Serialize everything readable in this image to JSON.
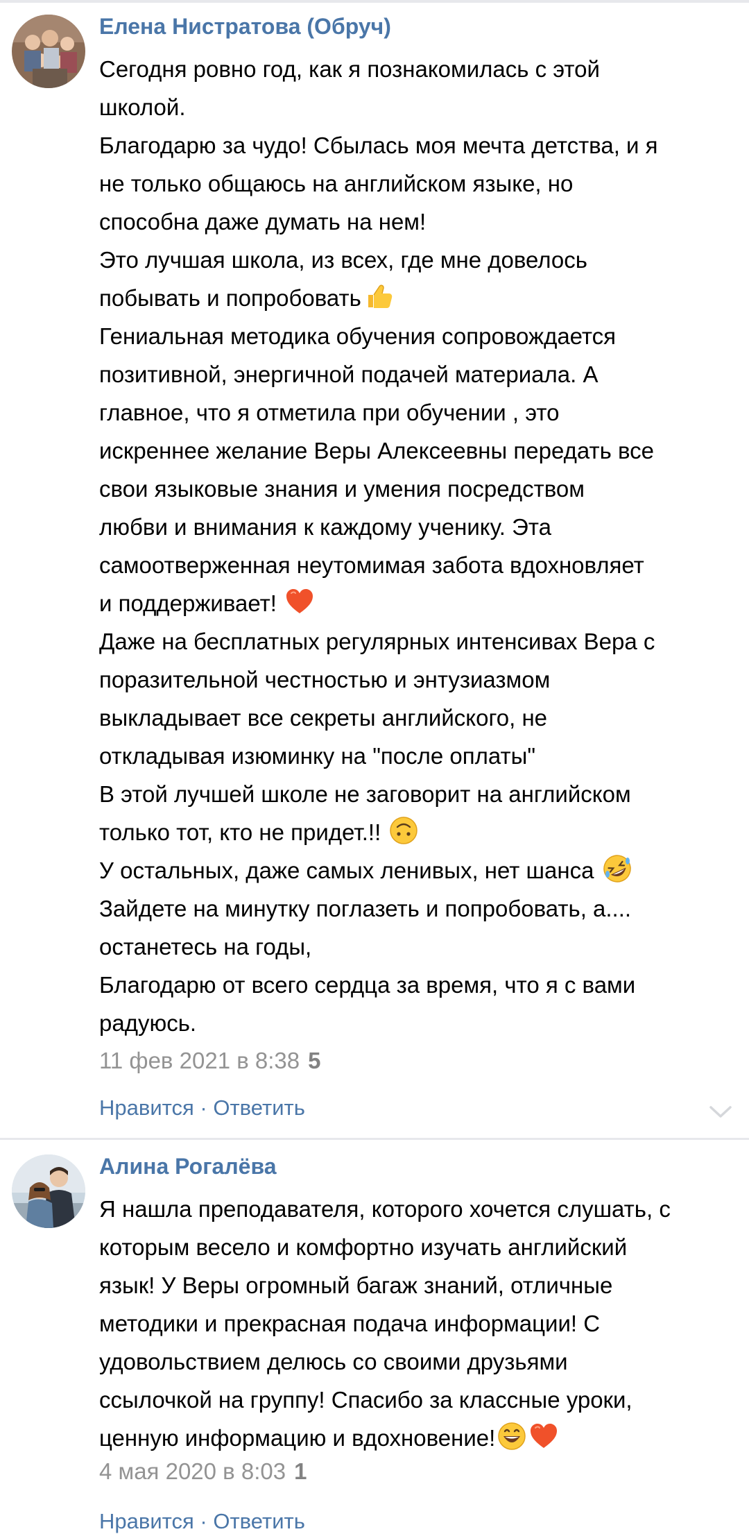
{
  "comments": [
    {
      "author": "Елена Нистратова (Обруч)",
      "lines": [
        "Сегодня ровно год, как я познакомилась с этой",
        "школой.",
        "Благодарю за чудо! Сбылась моя мечта детства, и я",
        "не только общаюсь на английском языке, но",
        "способна даже думать на нем!",
        "Это лучшая школа, из всех, где мне довелось",
        "побывать и попробовать",
        "Гениальная методика обучения сопровождается",
        "позитивной, энергичной подачей материала. А",
        "главное, что я отметила при обучении , это",
        "искреннее желание Веры Алексеевны передать все",
        "свои языковые знания и умения посредством",
        "любви и внимания к каждому ученику. Эта",
        "самоотверженная неутомимая забота вдохновляет",
        "и поддерживает!",
        "Даже на бесплатных регулярных интенсивах Вера с",
        "поразительной честностью и энтузиазмом",
        "выкладывает все секреты английского, не",
        "откладывая изюминку на \"после оплаты\"",
        "В этой лучшей школе не заговорит на английском",
        "только тот, кто не придет.!!",
        "У остальных, даже самых ленивых, нет шанса",
        "Зайдете на минутку поглазеть и попробовать, а....",
        "останетесь на годы,",
        "Благодарю от всего сердца за время, что я с вами",
        "радуюсь."
      ],
      "emojis": [
        "thumbs-up-emoji",
        "heart-emoji",
        "upside-down-face-emoji",
        "rolling-laughing-emoji"
      ],
      "date": "11 фев 2021 в 8:38",
      "likes": "5",
      "like_label": "Нравится",
      "separator": " · ",
      "reply_label": "Ответить"
    },
    {
      "author": "Алина Рогалёва",
      "lines": [
        "Я нашла преподавателя, которого хочется слушать, с",
        "которым весело и комфортно изучать английский",
        "язык! У Веры огромный багаж знаний, отличные",
        "методики и прекрасная подача информации! С",
        "удовольствием делюсь со своими друзьями",
        "ссылочкой на группу! Спасибо за классные уроки,",
        "ценную информацию и вдохновение!"
      ],
      "emojis": [
        "grinning-face-emoji",
        "heart-emoji"
      ],
      "date": "4 мая 2020 в 8:03",
      "likes": "1",
      "like_label": "Нравится",
      "separator": " · ",
      "reply_label": "Ответить"
    }
  ],
  "colors": {
    "link": "#4a76a8",
    "meta": "#939393",
    "divider": "#e7e8ec"
  }
}
